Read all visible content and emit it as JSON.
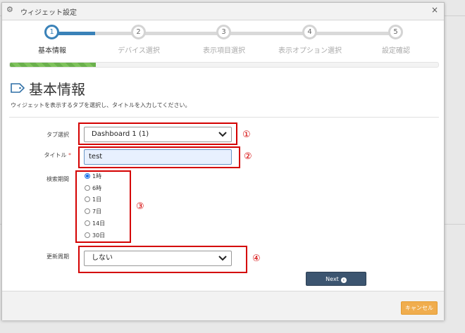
{
  "window": {
    "title": "ウィジェット設定",
    "close": "×"
  },
  "stepper": {
    "current": 1,
    "steps": [
      {
        "num": "1",
        "label": "基本情報"
      },
      {
        "num": "2",
        "label": "デバイス選択"
      },
      {
        "num": "3",
        "label": "表示項目選択"
      },
      {
        "num": "4",
        "label": "表示オプション選択"
      },
      {
        "num": "5",
        "label": "設定確認"
      }
    ]
  },
  "progress": {
    "percent": 20
  },
  "section": {
    "title": "基本情報",
    "description": "ウィジェットを表示するタブを選択し、タイトルを入力してください。"
  },
  "form": {
    "tab_label": "タブ選択",
    "tab_value": "Dashboard 1 (1)",
    "title_label": "タイトル",
    "title_required": "*",
    "title_value": "test",
    "period_label": "検索期間",
    "period_options": [
      "1時",
      "6時",
      "1日",
      "7日",
      "14日",
      "30日"
    ],
    "period_selected": 0,
    "refresh_label": "更新周期",
    "refresh_value": "しない"
  },
  "annotations": [
    "①",
    "②",
    "③",
    "④"
  ],
  "buttons": {
    "next": "Next",
    "cancel": "キャンセル"
  },
  "colors": {
    "accent": "#3a82b8",
    "annotation": "#d40000",
    "cancel": "#f0ad4e",
    "next": "#3c5570"
  }
}
